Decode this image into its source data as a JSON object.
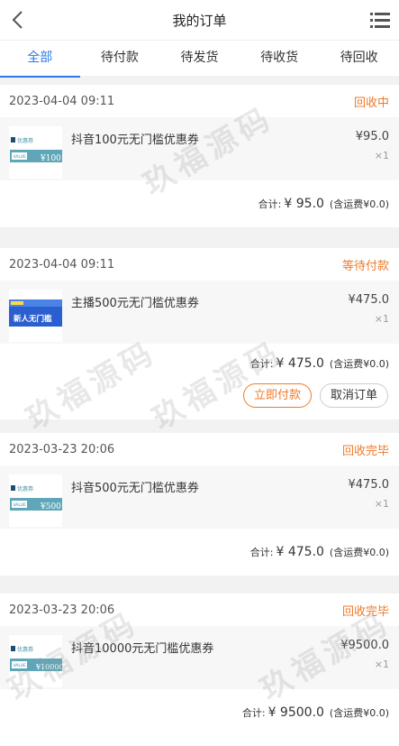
{
  "header": {
    "title": "我的订单"
  },
  "tabs": [
    "全部",
    "待付款",
    "待发货",
    "待收货",
    "待回收"
  ],
  "orders": [
    {
      "date": "2023-04-04 09:11",
      "status": "回收中",
      "name": "抖音100元无门槛优惠券",
      "price": "¥95.0",
      "qty": "×1",
      "total_label": "合计:",
      "total": "¥ 95.0",
      "shipping": "(含运费¥0.0)",
      "thumb": {
        "type": "voucher",
        "brand": "优惠券",
        "value_tag": "VALUE",
        "amount": "¥100"
      }
    },
    {
      "date": "2023-04-04 09:11",
      "status": "等待付款",
      "name": "主播500元无门槛优惠券",
      "price": "¥475.0",
      "qty": "×1",
      "total_label": "合计:",
      "total": "¥ 475.0",
      "shipping": "(含运费¥0.0)",
      "thumb": {
        "type": "newbie",
        "text": "新人无门槛"
      },
      "pay_label": "立即付款",
      "cancel_label": "取消订单"
    },
    {
      "date": "2023-03-23 20:06",
      "status": "回收完毕",
      "name": "抖音500元无门槛优惠券",
      "price": "¥475.0",
      "qty": "×1",
      "total_label": "合计:",
      "total": "¥ 475.0",
      "shipping": "(含运费¥0.0)",
      "thumb": {
        "type": "voucher",
        "brand": "优惠券",
        "value_tag": "VALUE",
        "amount": "¥500"
      }
    },
    {
      "date": "2023-03-23 20:06",
      "status": "回收完毕",
      "name": "抖音10000元无门槛优惠券",
      "price": "¥9500.0",
      "qty": "×1",
      "total_label": "合计:",
      "total": "¥ 9500.0",
      "shipping": "(含运费¥0.0)",
      "thumb": {
        "type": "voucher",
        "brand": "优惠券",
        "value_tag": "VALUE",
        "amount": "¥10000"
      }
    }
  ],
  "watermark": "玖福源码",
  "colors": {
    "accent": "#2a7be4",
    "status": "#ef7a28",
    "background": "#f2f2f2"
  }
}
